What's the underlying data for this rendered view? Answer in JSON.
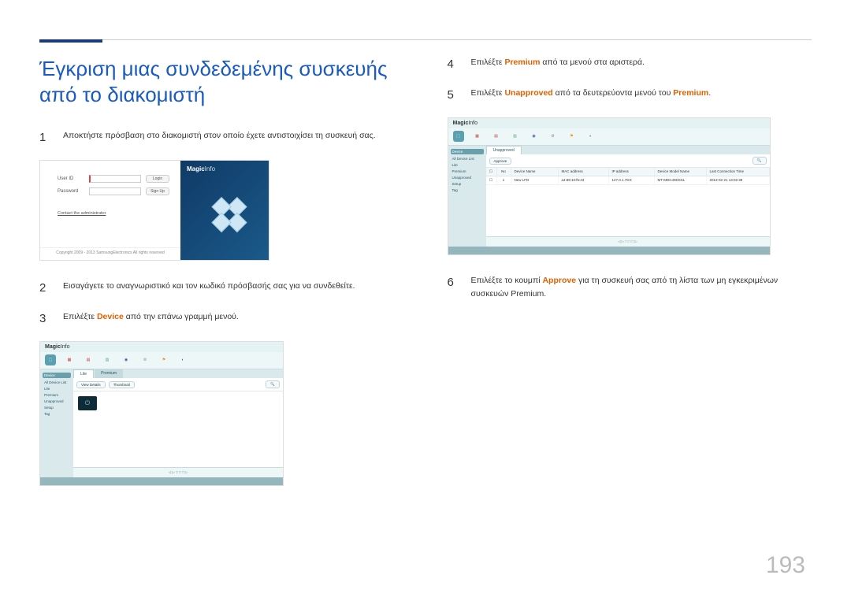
{
  "pageNumber": "193",
  "title": "Έγκριση μιας συνδεδεμένης συσκευής από το διακομιστή",
  "steps": {
    "s1": {
      "num": "1",
      "text": "Αποκτήστε πρόσβαση στο διακομιστή στον οποίο έχετε αντιστοιχίσει τη συσκευή σας."
    },
    "s2": {
      "num": "2",
      "text": "Εισαγάγετε το αναγνωριστικό και τον κωδικό πρόσβασής σας για να συνδεθείτε."
    },
    "s3": {
      "num": "3",
      "pre": "Επιλέξτε ",
      "kw": "Device",
      "post": " από την επάνω γραμμή μενού."
    },
    "s4": {
      "num": "4",
      "pre": "Επιλέξτε ",
      "kw": "Premium",
      "post": " από τα μενού στα αριστερά."
    },
    "s5": {
      "num": "5",
      "pre": "Επιλέξτε ",
      "kw1": "Unapproved",
      "mid": " από τα δευτερεύοντα μενού του ",
      "kw2": "Premium",
      "post": "."
    },
    "s6": {
      "num": "6",
      "pre": "Επιλέξτε το κουμπί ",
      "kw": "Approve",
      "post": " για τη συσκευή σας από τη λίστα των μη εγκεκριμένων συσκευών Premium."
    }
  },
  "login": {
    "brandA": "Magic",
    "brandB": "Info",
    "userLabel": "User ID",
    "passLabel": "Password",
    "loginBtn": "Login",
    "signupBtn": "Sign Up",
    "contact": "Contact the administrator",
    "copyright": "Copyright 2009 - 2013 SamsungElectronics All rights reserved"
  },
  "app": {
    "brandA": "Magic",
    "brandB": "Info",
    "tabs": [
      "Lite",
      "Premium"
    ],
    "sidebarHead": "Device",
    "sidebarItems": [
      "All Device List",
      "Lite",
      "Premium",
      "Unapproved",
      "Setup",
      "Tag"
    ],
    "filterView": "View Details",
    "filterThumb": "Thumbnail",
    "pager": "◁ ▷ □ □ □ ▷"
  },
  "list": {
    "headers": {
      "num": "No",
      "name": "Device Name",
      "mac": "MAC address",
      "ip": "IP address",
      "model": "Device Model Name",
      "time": "Last Connection Time"
    },
    "row": {
      "num": "1",
      "name": "New LFD",
      "mac": "a4:89:10:f5:43",
      "ip": "127.0.1.78:0",
      "model": "MT-MDC40DSSL",
      "time": "2013-02-21 13:02:39"
    },
    "approve": "Approve",
    "emptyTabs": [
      "Unapproved"
    ]
  }
}
